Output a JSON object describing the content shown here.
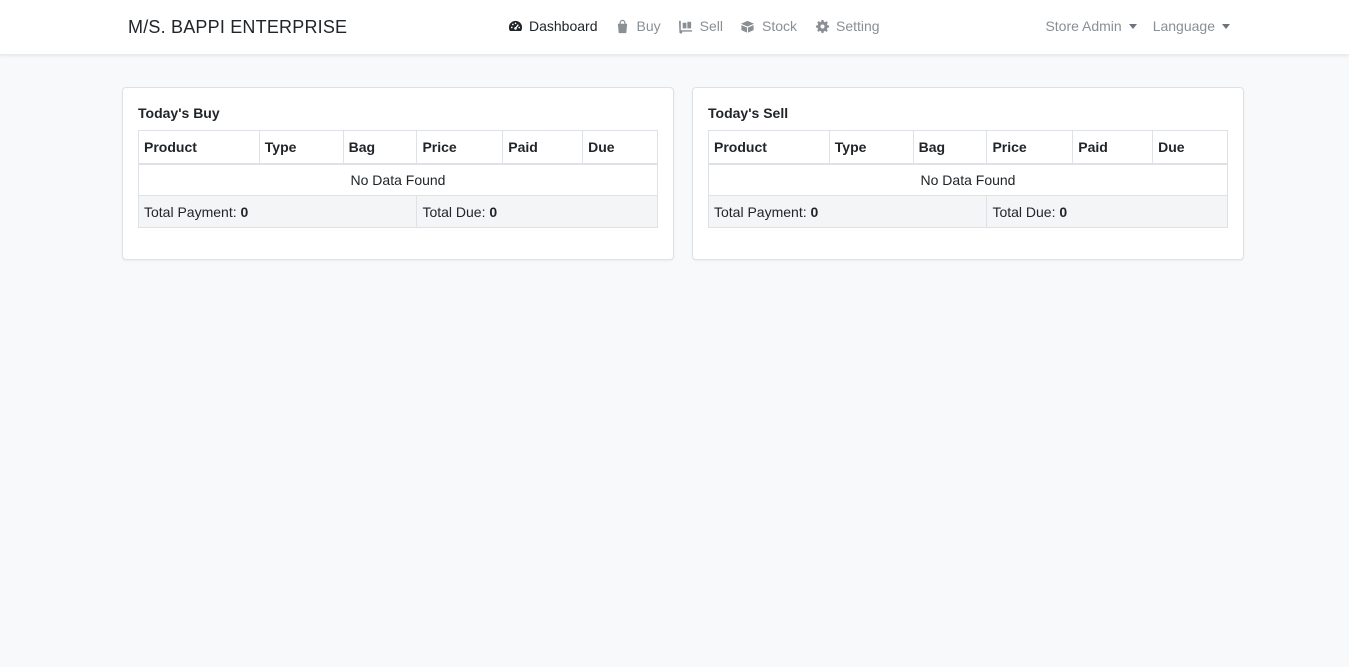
{
  "brand": "M/S. BAPPI ENTERPRISE",
  "nav": [
    {
      "label": "Dashboard",
      "icon": "dashboard-icon",
      "active": true
    },
    {
      "label": "Buy",
      "icon": "shopping-bag-icon",
      "active": false
    },
    {
      "label": "Sell",
      "icon": "dolly-icon",
      "active": false
    },
    {
      "label": "Stock",
      "icon": "boxes-icon",
      "active": false
    },
    {
      "label": "Setting",
      "icon": "gear-icon",
      "active": false
    }
  ],
  "user_menu": {
    "label": "Store Admin"
  },
  "language_menu": {
    "label": "Language"
  },
  "buy_card": {
    "title": "Today's Buy",
    "columns": [
      "Product",
      "Type",
      "Bag",
      "Price",
      "Paid",
      "Due"
    ],
    "empty_text": "No Data Found",
    "total_payment_label": "Total Payment:",
    "total_payment_value": "0",
    "total_due_label": "Total Due:",
    "total_due_value": "0"
  },
  "sell_card": {
    "title": "Today's Sell",
    "columns": [
      "Product",
      "Type",
      "Bag",
      "Price",
      "Paid",
      "Due"
    ],
    "empty_text": "No Data Found",
    "total_payment_label": "Total Payment:",
    "total_payment_value": "0",
    "total_due_label": "Total Due:",
    "total_due_value": "0"
  }
}
